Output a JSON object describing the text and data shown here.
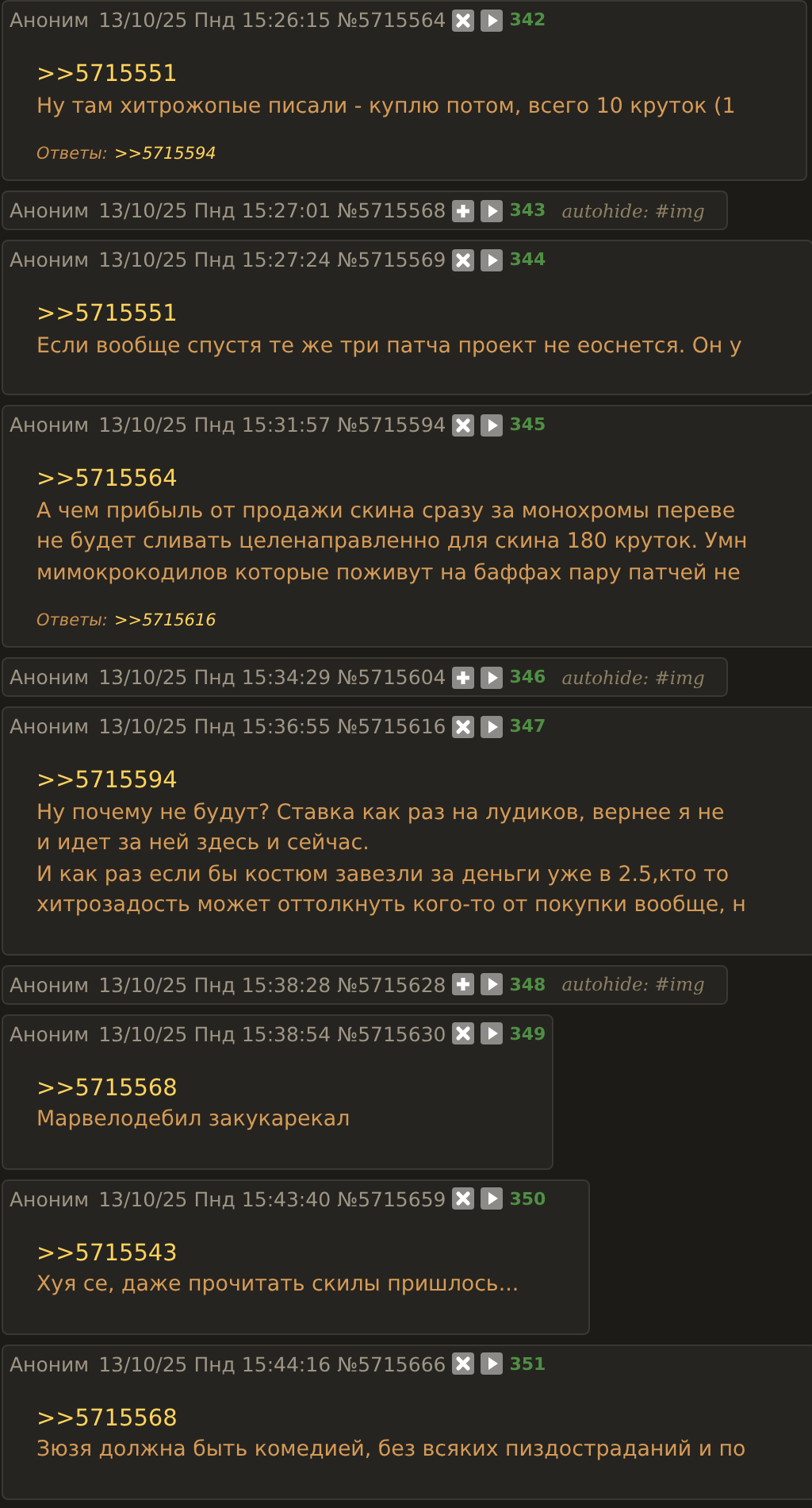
{
  "posts": [
    {
      "number": "342",
      "author": "Аноним",
      "date": "13/10/25 Пнд 15:26:15",
      "post_id": "№5715564",
      "hidden": false,
      "quote": ">>5715551",
      "lines": [
        "Ну там хитрожопые писали - куплю потом, всего 10 круток (1"
      ],
      "replies_label": "Ответы:",
      "replies": [
        ">>5715594"
      ]
    },
    {
      "number": "343",
      "author": "Аноним",
      "date": "13/10/25 Пнд 15:27:01",
      "post_id": "№5715568",
      "hidden": true,
      "autohide": "autohide: #img"
    },
    {
      "number": "344",
      "author": "Аноним",
      "date": "13/10/25 Пнд 15:27:24",
      "post_id": "№5715569",
      "hidden": false,
      "quote": ">>5715551",
      "lines": [
        "Если вообще спустя те же три патча проект не еоснется. Он у"
      ]
    },
    {
      "number": "345",
      "author": "Аноним",
      "date": "13/10/25 Пнд 15:31:57",
      "post_id": "№5715594",
      "hidden": false,
      "quote": ">>5715564",
      "lines": [
        "А чем прибыль от продажи скина сразу за монохромы переве",
        "не будет сливать целенаправленно для скина 180 круток. Умн",
        "мимокрокодилов которые поживут на баффах пару патчей не"
      ],
      "replies_label": "Ответы:",
      "replies": [
        ">>5715616"
      ]
    },
    {
      "number": "346",
      "author": "Аноним",
      "date": "13/10/25 Пнд 15:34:29",
      "post_id": "№5715604",
      "hidden": true,
      "autohide": "autohide: #img"
    },
    {
      "number": "347",
      "author": "Аноним",
      "date": "13/10/25 Пнд 15:36:55",
      "post_id": "№5715616",
      "hidden": false,
      "quote": ">>5715594",
      "lines": [
        "Ну почему не будут? Ставка как раз на лудиков, вернее я не",
        "и идет за ней здесь и сейчас.",
        "И как раз если бы костюм завезли за деньги уже в 2.5,кто то",
        "хитрозадость может оттолкнуть кого-то от покупки вообще, н"
      ]
    },
    {
      "number": "348",
      "author": "Аноним",
      "date": "13/10/25 Пнд 15:38:28",
      "post_id": "№5715628",
      "hidden": true,
      "autohide": "autohide: #img"
    },
    {
      "number": "349",
      "author": "Аноним",
      "date": "13/10/25 Пнд 15:38:54",
      "post_id": "№5715630",
      "hidden": false,
      "quote": ">>5715568",
      "lines": [
        "Марвелодебил закукарекал"
      ]
    },
    {
      "number": "350",
      "author": "Аноним",
      "date": "13/10/25 Пнд 15:43:40",
      "post_id": "№5715659",
      "hidden": false,
      "quote": ">>5715543",
      "lines": [
        "Хуя се, даже прочитать скилы пришлось..."
      ]
    },
    {
      "number": "351",
      "author": "Аноним",
      "date": "13/10/25 Пнд 15:44:16",
      "post_id": "№5715666",
      "hidden": false,
      "quote": ">>5715568",
      "lines": [
        "Зюзя должна быть комедией, без всяких пиздостраданий и по"
      ]
    }
  ]
}
